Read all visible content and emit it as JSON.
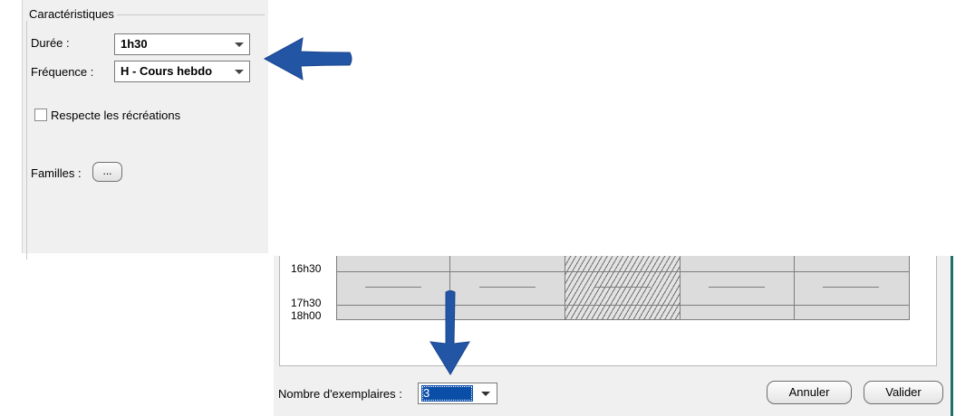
{
  "properties_panel": {
    "group_title": "Caractéristiques",
    "duree": {
      "label": "Durée :",
      "value": "1h30"
    },
    "frequence": {
      "label": "Fréquence :",
      "value": "H - Cours hebdo"
    },
    "recreations": {
      "label": "Respecte les récréations",
      "checked": false
    },
    "familles": {
      "label": "Familles :",
      "button_label": "..."
    }
  },
  "schedule": {
    "time_labels": [
      "16h30",
      "17h30",
      "18h00"
    ],
    "hatched_column_index": 2
  },
  "footer": {
    "nombre_label": "Nombre d'exemplaires :",
    "nombre_value": "3",
    "annuler_label": "Annuler",
    "valider_label": "Valider"
  },
  "annotations": {
    "arrow_color": "#2255a4"
  }
}
